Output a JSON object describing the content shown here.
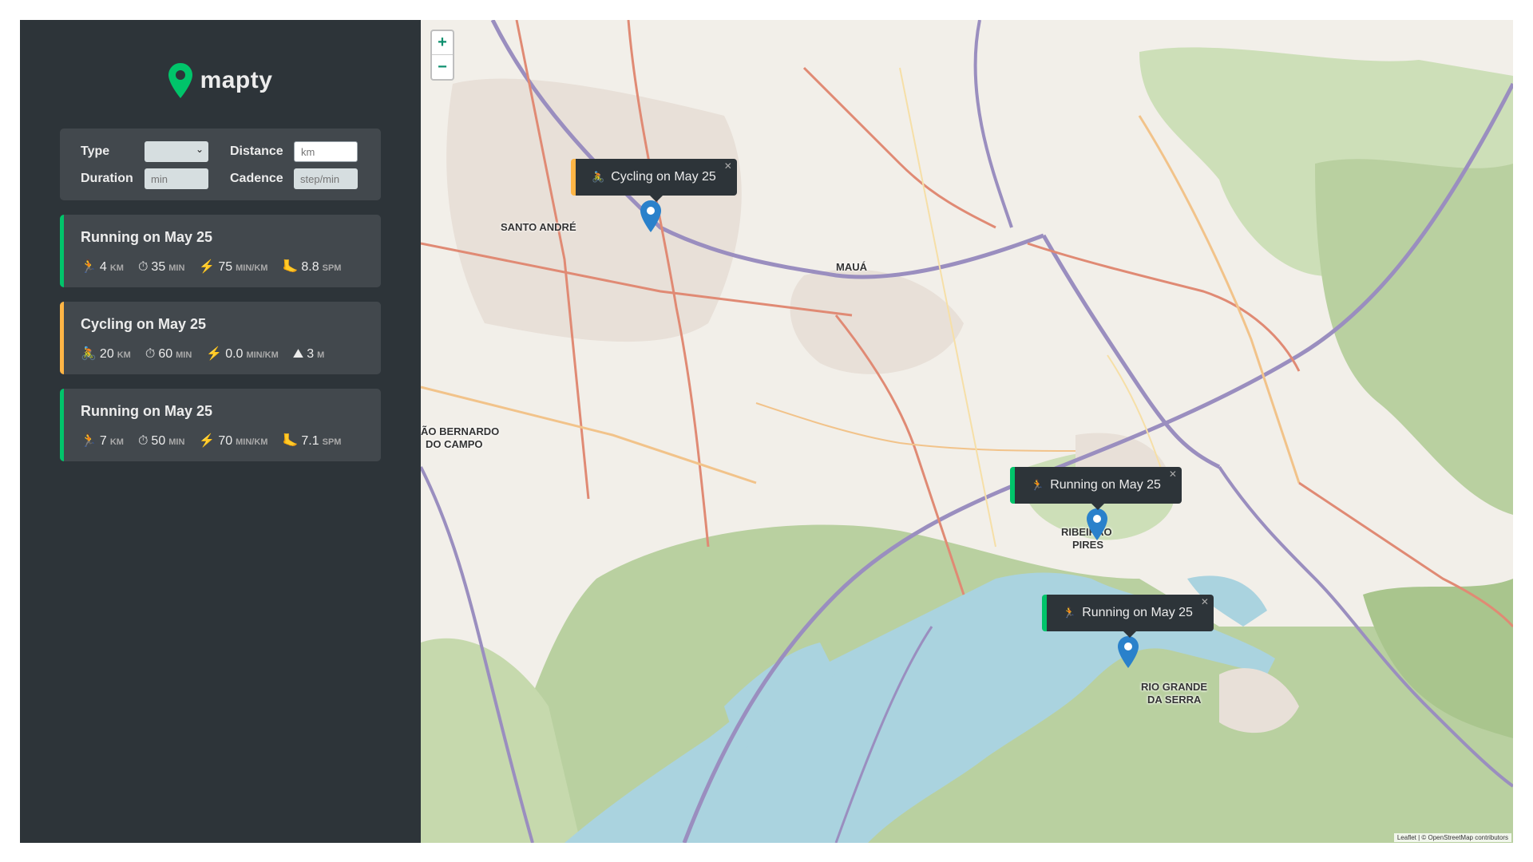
{
  "app": {
    "logo_text": "mapty"
  },
  "form": {
    "type_label": "Type",
    "distance_label": "Distance",
    "distance_placeholder": "km",
    "duration_label": "Duration",
    "duration_placeholder": "min",
    "cadence_label": "Cadence",
    "cadence_placeholder": "step/min"
  },
  "workouts": [
    {
      "title": "Running on May 25",
      "type": "running",
      "distance": "4",
      "distance_unit": "km",
      "duration": "35",
      "duration_unit": "min",
      "pace": "75",
      "pace_unit": "min/km",
      "extra": "8.8",
      "extra_unit": "spm"
    },
    {
      "title": "Cycling on May 25",
      "type": "cycling",
      "distance": "20",
      "distance_unit": "km",
      "duration": "60",
      "duration_unit": "min",
      "pace": "0.0",
      "pace_unit": "min/km",
      "extra": "3",
      "extra_unit": "m"
    },
    {
      "title": "Running on May 25",
      "type": "running",
      "distance": "7",
      "distance_unit": "km",
      "duration": "50",
      "duration_unit": "min",
      "pace": "70",
      "pace_unit": "min/km",
      "extra": "7.1",
      "extra_unit": "spm"
    }
  ],
  "map": {
    "zoom_in": "+",
    "zoom_out": "−",
    "popups": [
      {
        "text": "Cycling on May 25",
        "icon": "🚴"
      },
      {
        "text": "Running on May 25",
        "icon": "🏃"
      },
      {
        "text": "Running on May 25",
        "icon": "🏃"
      }
    ],
    "labels": {
      "santo_andre": "SANTO ANDRÉ",
      "maua": "MAUÁ",
      "sbc_1": "ÃO BERNARDO",
      "sbc_2": "DO CAMPO",
      "ribeirao_1": "RIBEIRÃO",
      "ribeirao_2": "PIRES",
      "rio_grande_1": "RIO GRANDE",
      "rio_grande_2": "DA SERRA"
    },
    "attribution": "Leaflet | © OpenStreetMap contributors"
  },
  "colors": {
    "running": "#00c46a",
    "cycling": "#ffb545",
    "marker": "#2a81cb"
  }
}
